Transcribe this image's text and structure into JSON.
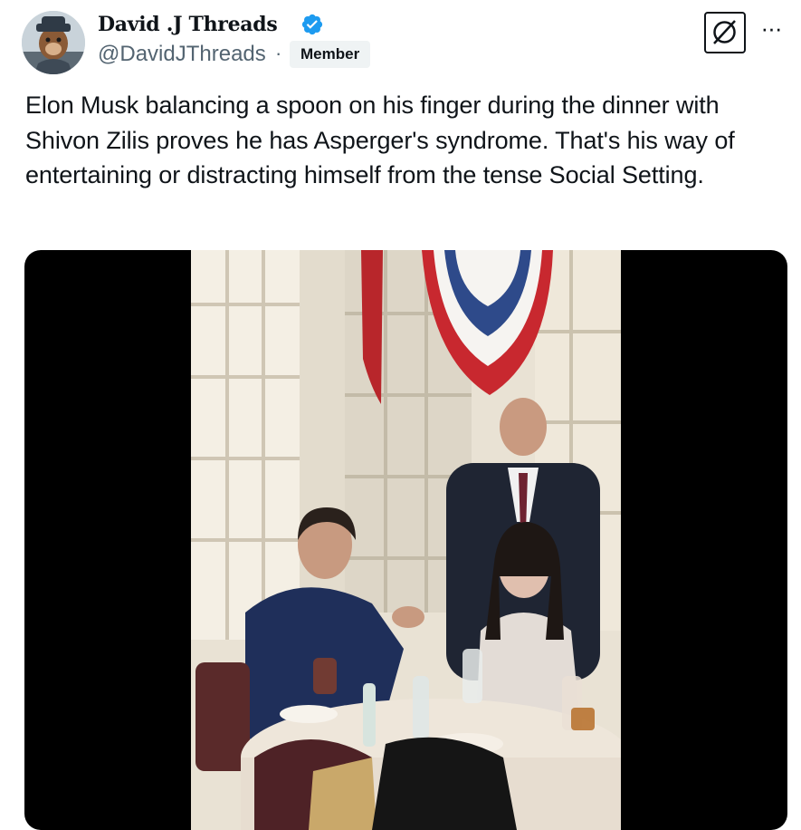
{
  "author": {
    "display_name": "David .J Threads",
    "handle": "@DavidJThreads",
    "separator": "·",
    "badge": "Member",
    "verified": true,
    "verified_color": "#1d9bf0"
  },
  "actions": {
    "grok_icon": "slashed-circle-icon",
    "more_label": "···"
  },
  "tweet": {
    "text": "Elon Musk balancing a spoon on his finger during the dinner with Shivon Zilis proves he has Asperger's syndrome. That's his way of entertaining or distracting himself from the tense Social Setting."
  },
  "media": {
    "type": "video",
    "background": "#000000"
  }
}
